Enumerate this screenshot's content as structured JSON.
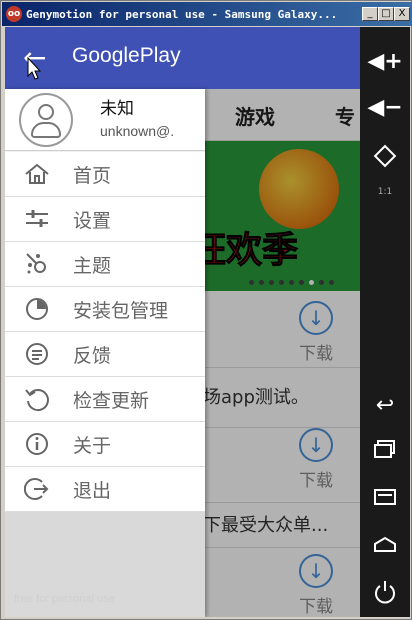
{
  "window": {
    "title": "Genymotion for personal use - Samsung Galaxy...",
    "icon": "genymotion-icon",
    "buttons": {
      "minimize": "_",
      "maximize": "□",
      "close": "X"
    }
  },
  "app": {
    "title": "GooglePlay",
    "back_icon": "back-arrow-icon",
    "tabs": [
      "游戏",
      "专"
    ],
    "apps": [
      {
        "action": "下载"
      },
      {
        "action": "下载",
        "desc": "场app测试。"
      },
      {
        "action": "下载",
        "desc": "下最受大众单..."
      },
      {
        "action": "下载"
      }
    ],
    "banner": {
      "slogan": "狂欢季"
    }
  },
  "drawer": {
    "user_name": "未知",
    "user_email": "unknown@.",
    "items": [
      {
        "label": "首页",
        "icon": "home-icon"
      },
      {
        "label": "设置",
        "icon": "settings-sliders-icon"
      },
      {
        "label": "主题",
        "icon": "theme-icon"
      },
      {
        "label": "安装包管理",
        "icon": "package-icon"
      },
      {
        "label": "反馈",
        "icon": "feedback-icon"
      },
      {
        "label": "检查更新",
        "icon": "refresh-icon"
      },
      {
        "label": "关于",
        "icon": "info-icon"
      },
      {
        "label": "退出",
        "icon": "exit-icon"
      }
    ]
  },
  "watermark": "free for personal use",
  "emulator_controls": [
    "volume-up-icon",
    "volume-down-icon",
    "rotate-icon",
    "scale-1-1-icon",
    "back-icon",
    "recent-apps-icon",
    "menu-icon",
    "home-icon",
    "power-icon"
  ],
  "scale_label": "1:1"
}
